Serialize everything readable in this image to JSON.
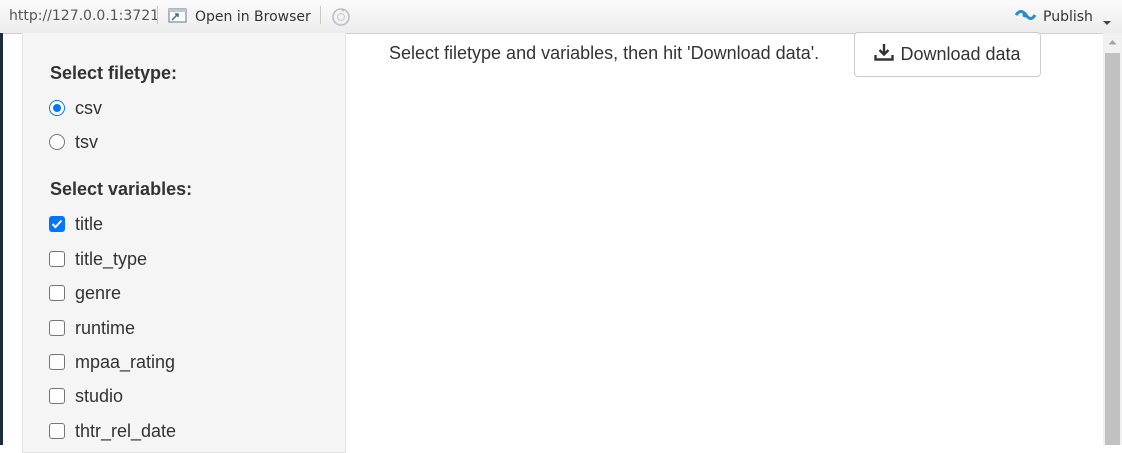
{
  "toolbar": {
    "url": "http://127.0.0.1:3721",
    "open_in_browser": "Open in Browser",
    "publish": "Publish"
  },
  "sidebar": {
    "filetype_label": "Select filetype:",
    "filetypes": [
      {
        "label": "csv",
        "selected": true
      },
      {
        "label": "tsv",
        "selected": false
      }
    ],
    "variables_label": "Select variables:",
    "variables": [
      {
        "label": "title",
        "checked": true
      },
      {
        "label": "title_type",
        "checked": false
      },
      {
        "label": "genre",
        "checked": false
      },
      {
        "label": "runtime",
        "checked": false
      },
      {
        "label": "mpaa_rating",
        "checked": false
      },
      {
        "label": "studio",
        "checked": false
      },
      {
        "label": "thtr_rel_date",
        "checked": false
      }
    ]
  },
  "main": {
    "instructions": "Select filetype and variables, then hit 'Download data'.",
    "download_button": "Download data"
  },
  "colors": {
    "accent": "#0075ff",
    "sidebar_bg": "#f5f5f5",
    "publish_icon": "#2a8bd1"
  }
}
